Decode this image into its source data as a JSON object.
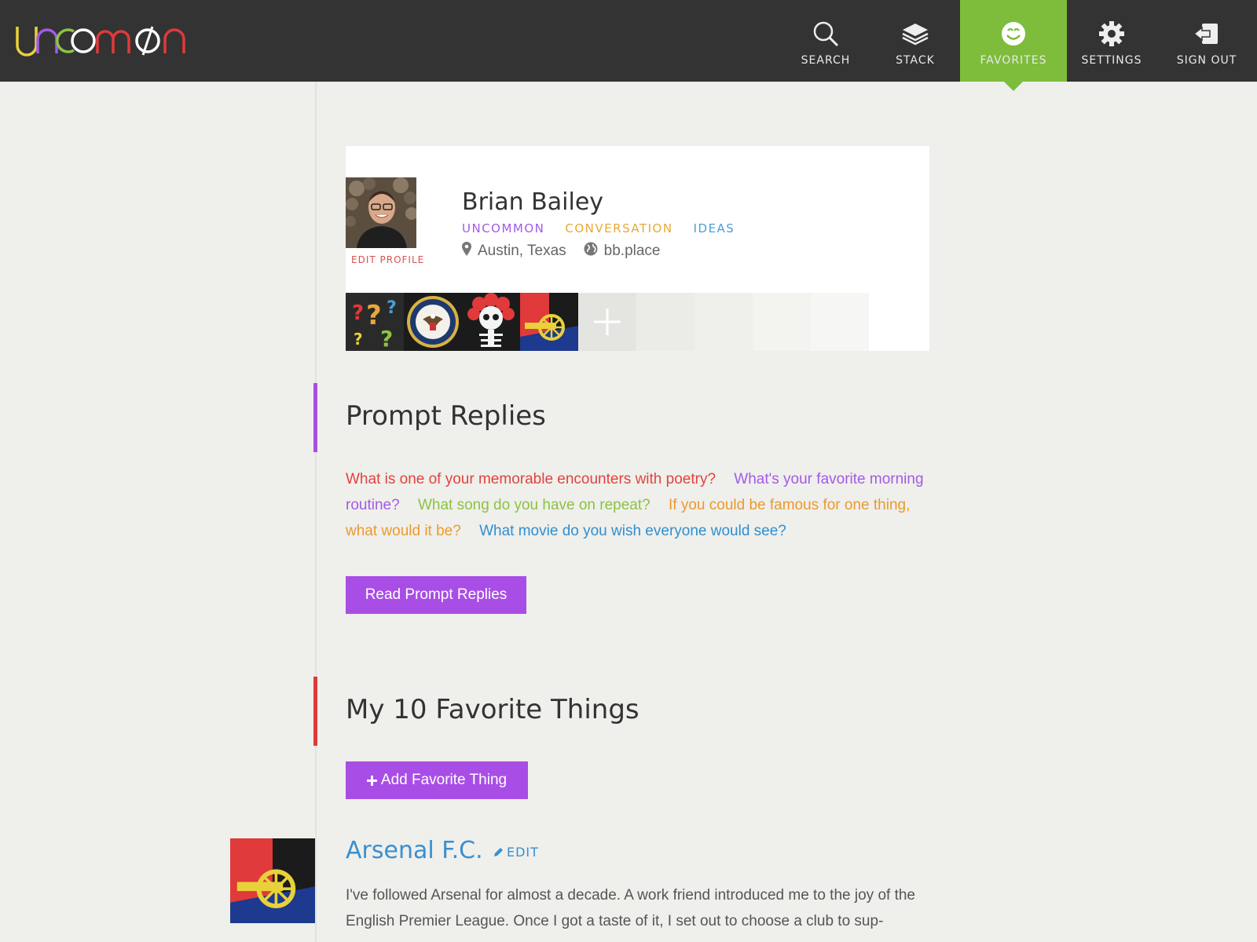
{
  "colors": {
    "topbar": "#333333",
    "active_nav": "#7dbd3b",
    "button": "#a84ee6",
    "link_blue": "#3a8fcf",
    "marker_purple": "#a84ee6",
    "marker_red": "#e03a3a"
  },
  "nav": {
    "items": [
      {
        "label": "SEARCH",
        "icon": "search-icon"
      },
      {
        "label": "STACK",
        "icon": "stack-icon"
      },
      {
        "label": "FAVORITES",
        "icon": "smiley-icon"
      },
      {
        "label": "SETTINGS",
        "icon": "gear-icon"
      },
      {
        "label": "SIGN OUT",
        "icon": "sign-out-icon"
      }
    ]
  },
  "profile": {
    "name": "Brian Bailey",
    "edit_label": "EDIT PROFILE",
    "tags": [
      "UNCOMMON",
      "CONVERSATION",
      "IDEAS"
    ],
    "location": "Austin, Texas",
    "website": "bb.place",
    "badges": [
      "question-marks-badge",
      "seal-badge",
      "skull-badge",
      "arsenal-badge",
      "add-badge"
    ]
  },
  "prompt_replies": {
    "title": "Prompt Replies",
    "prompts": [
      {
        "text": "What is one of your memorable encounters with poetry?",
        "color": "#e0443c"
      },
      {
        "text": "What's your favorite morning routine?",
        "color": "#a35ae6"
      },
      {
        "text": "What song do you have on repeat?",
        "color": "#8cc342"
      },
      {
        "text": "If you could be famous for one thing, what would it be?",
        "color": "#eb9a2c"
      },
      {
        "text": "What movie do you wish everyone would see?",
        "color": "#2f8fcf"
      }
    ],
    "button_label": "Read Prompt Replies"
  },
  "favorites": {
    "title": "My 10 Favorite Things",
    "add_label": "Add Favorite Thing",
    "items": [
      {
        "title": "Arsenal F.C.",
        "edit_label": "EDIT",
        "text": "I've followed Arsenal for almost a decade. A work friend introduced me to the joy of the English Premier League. Once I got a taste of it, I set out to choose a club to sup-"
      }
    ]
  }
}
